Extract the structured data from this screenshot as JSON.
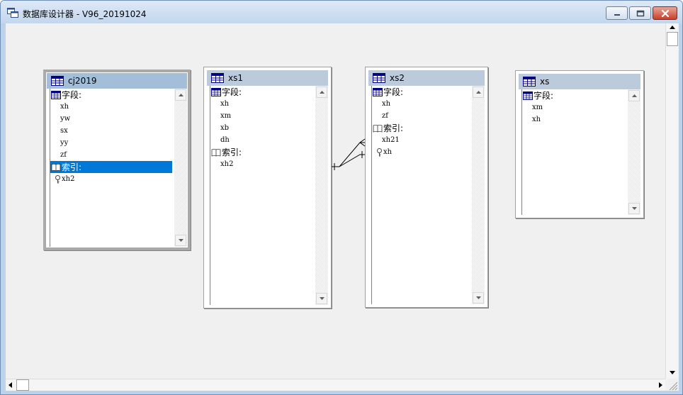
{
  "window": {
    "title": "数据库设计器 - V96_20191024",
    "controls": [
      "minimize-icon",
      "maximize-icon",
      "close-icon"
    ]
  },
  "labels": {
    "fields_section": "字段:",
    "indexes_section": "索引:"
  },
  "tables": [
    {
      "name": "cj2019",
      "fields": [
        "xh",
        "yw",
        "sx",
        "yy",
        "zf"
      ],
      "indexes": [
        "xh2"
      ],
      "selected": "indexes-section"
    },
    {
      "name": "xs1",
      "fields": [
        "xh",
        "xm",
        "xb",
        "dh"
      ],
      "indexes": [
        "xh2"
      ]
    },
    {
      "name": "xs2",
      "fields": [
        "xh",
        "zf"
      ],
      "indexes": [
        "xh21",
        "xh"
      ]
    },
    {
      "name": "xs",
      "fields": [
        "xm",
        "xh"
      ],
      "indexes": []
    }
  ],
  "relationships": [
    {
      "from": "xs1",
      "to": "xs2",
      "type": "one-to-many"
    },
    {
      "from": "xs1",
      "to": "xs2",
      "type": "one-to-one"
    }
  ],
  "colors": {
    "selection": "#0078d7",
    "header_active": "#a3bed8",
    "header": "#bccbdb",
    "canvas": "#f0f0f0"
  }
}
